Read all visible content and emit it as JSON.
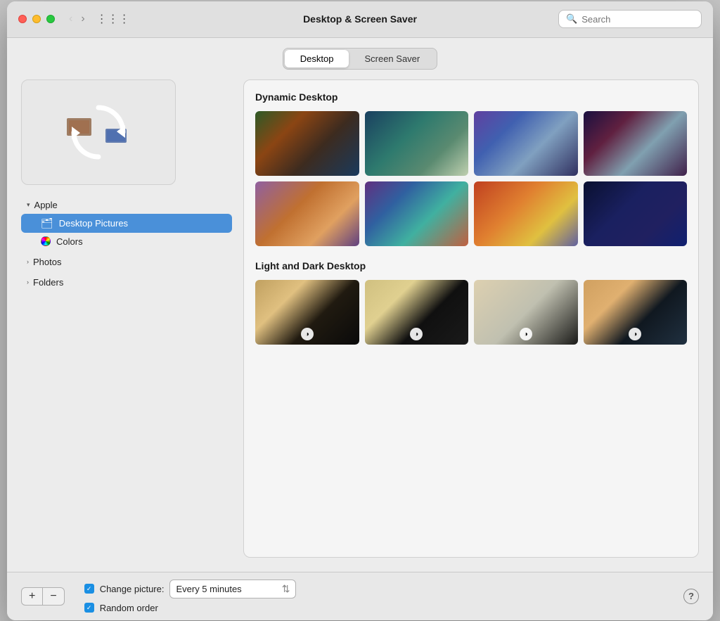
{
  "window": {
    "title": "Desktop & Screen Saver"
  },
  "titlebar": {
    "back_arrow": "‹",
    "forward_arrow": "›",
    "grid_icon": "⋮⋮⋮",
    "search_placeholder": "Search"
  },
  "tabs": {
    "items": [
      {
        "id": "desktop",
        "label": "Desktop"
      },
      {
        "id": "screensaver",
        "label": "Screen Saver"
      }
    ],
    "active": "desktop"
  },
  "sidebar": {
    "sections": [
      {
        "id": "apple",
        "label": "Apple",
        "expanded": true,
        "items": [
          {
            "id": "desktop-pictures",
            "label": "Desktop Pictures",
            "type": "folder",
            "selected": true
          },
          {
            "id": "colors",
            "label": "Colors",
            "type": "color"
          }
        ]
      },
      {
        "id": "photos",
        "label": "Photos",
        "expanded": false,
        "items": []
      },
      {
        "id": "folders",
        "label": "Folders",
        "expanded": false,
        "items": []
      }
    ]
  },
  "wallpapers": {
    "sections": [
      {
        "id": "dynamic",
        "title": "Dynamic Desktop",
        "items": [
          {
            "id": "w1",
            "class": "w1"
          },
          {
            "id": "w2",
            "class": "w2"
          },
          {
            "id": "w3",
            "class": "w3"
          },
          {
            "id": "w4",
            "class": "w4"
          },
          {
            "id": "w5",
            "class": "w5"
          },
          {
            "id": "w6",
            "class": "w6"
          },
          {
            "id": "w7",
            "class": "w7"
          },
          {
            "id": "w8",
            "class": "w8"
          }
        ]
      },
      {
        "id": "lightdark",
        "title": "Light and Dark Desktop",
        "items": [
          {
            "id": "w9",
            "class": "w9",
            "has_icon": true
          },
          {
            "id": "w10",
            "class": "w10",
            "has_icon": true
          },
          {
            "id": "w11",
            "class": "w11",
            "has_icon": true
          },
          {
            "id": "w12",
            "class": "w12",
            "has_icon": true
          }
        ]
      }
    ]
  },
  "bottom_bar": {
    "add_label": "+",
    "remove_label": "−",
    "change_picture_label": "Change picture:",
    "change_picture_checked": true,
    "interval_value": "Every 5 minutes",
    "random_order_label": "Random order",
    "random_order_checked": true,
    "help_label": "?"
  }
}
